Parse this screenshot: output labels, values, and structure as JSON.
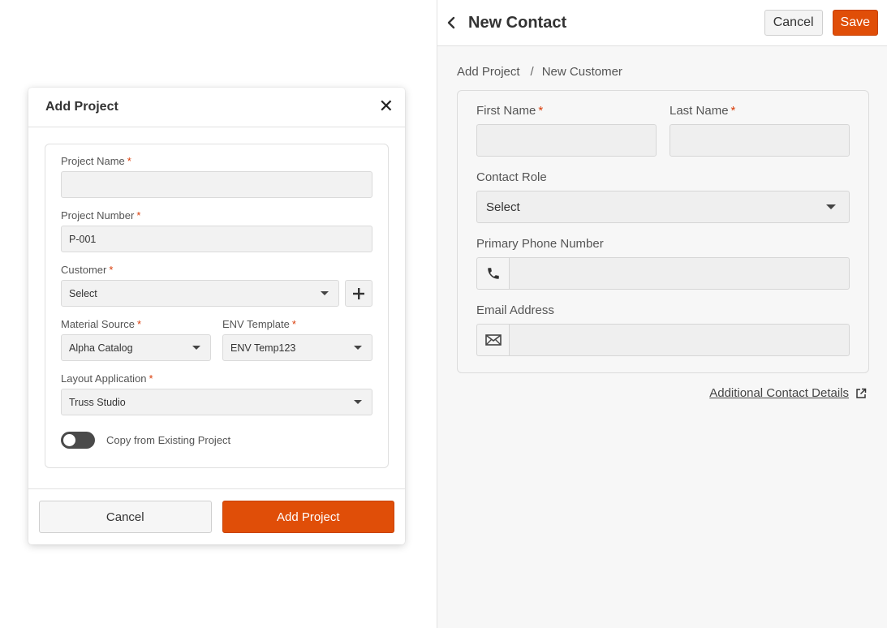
{
  "add_project": {
    "title": "Add Project",
    "fields": {
      "project_name": {
        "label": "Project Name",
        "value": "",
        "required_mark": "*"
      },
      "project_number": {
        "label": "Project Number",
        "value": "P-001",
        "required_mark": "*"
      },
      "customer": {
        "label": "Customer",
        "value": "Select",
        "required_mark": "*"
      },
      "material_source": {
        "label": "Material Source",
        "value": "Alpha Catalog",
        "required_mark": "*"
      },
      "env_template": {
        "label": "ENV Template",
        "value": "ENV Temp123",
        "required_mark": "*"
      },
      "layout_application": {
        "label": "Layout Application",
        "value": "Truss Studio",
        "required_mark": "*"
      }
    },
    "copy_toggle": {
      "label": "Copy from Existing Project",
      "on": false
    },
    "cancel_label": "Cancel",
    "submit_label": "Add Project",
    "close_glyph": "✕"
  },
  "new_contact": {
    "title": "New Contact",
    "cancel_label": "Cancel",
    "save_label": "Save",
    "breadcrumb": [
      "Add Project",
      "New Customer"
    ],
    "breadcrumb_separator": "/",
    "fields": {
      "first_name": {
        "label": "First Name",
        "value": "",
        "required_mark": "*"
      },
      "last_name": {
        "label": "Last Name",
        "value": "",
        "required_mark": "*"
      },
      "contact_role": {
        "label": "Contact Role",
        "value": "Select"
      },
      "primary_phone": {
        "label": "Primary Phone Number",
        "value": "",
        "icon": "phone-icon"
      },
      "email": {
        "label": "Email Address",
        "value": "",
        "icon": "envelope-icon"
      }
    },
    "additional_link": "Additional Contact Details"
  },
  "colors": {
    "primary": "#e04e08",
    "required": "#d93d0a",
    "toggle_off": "#4a4a4a"
  }
}
